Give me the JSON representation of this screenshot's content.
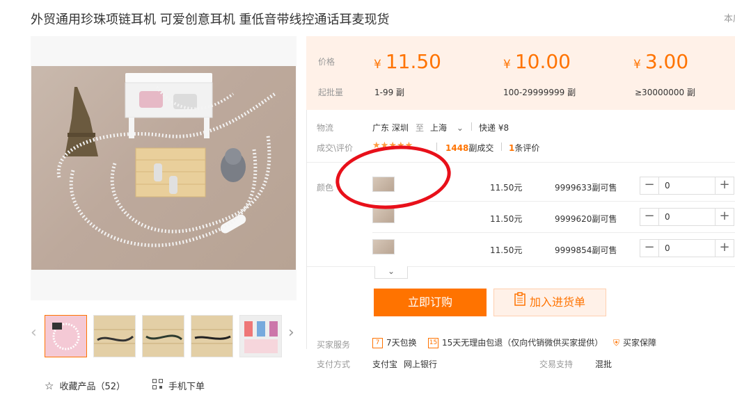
{
  "product": {
    "title": "外贸通用珍珠项链耳机 可爱创意耳机 重低音带线控通话耳麦现货",
    "corner_text": "本店"
  },
  "gallery": {
    "thumb_count": 5,
    "favorites_label": "收藏产品（52）",
    "mobile_order_label": "手机下单"
  },
  "pricing": {
    "price_label": "价格",
    "moq_label": "起批量",
    "tiers": [
      {
        "currency": "¥",
        "price": "11.50",
        "range": "1-99 副"
      },
      {
        "currency": "¥",
        "price": "10.00",
        "range": "100-29999999 副"
      },
      {
        "currency": "¥",
        "price": "3.00",
        "range": "≥30000000 副"
      }
    ],
    "accent_color": "#ff7300"
  },
  "logistics": {
    "label": "物流",
    "from": "广东 深圳",
    "to_word": "至",
    "destination": "上海",
    "shipping": "快递 ¥8"
  },
  "reviews": {
    "label": "成交\\评价",
    "deals_count": "1448",
    "deals_suffix": "副成交",
    "review_count": "1",
    "review_suffix": "条评价"
  },
  "variants": {
    "label": "颜色",
    "rows": [
      {
        "price": "11.50元",
        "stock": "9999633副可售",
        "qty": "0"
      },
      {
        "price": "11.50元",
        "stock": "9999620副可售",
        "qty": "0"
      },
      {
        "price": "11.50元",
        "stock": "9999854副可售",
        "qty": "0"
      }
    ]
  },
  "actions": {
    "order_label": "立即订购",
    "cart_label": "加入进货单"
  },
  "services": {
    "label": "买家服务",
    "items": [
      "7天包换",
      "15天无理由包退（仅向代销微供买家提供）",
      "买家保障"
    ],
    "payment_label": "支付方式",
    "payment_methods": [
      "支付宝",
      "网上银行"
    ],
    "trade_label": "交易支持",
    "trade_value": "混批"
  }
}
